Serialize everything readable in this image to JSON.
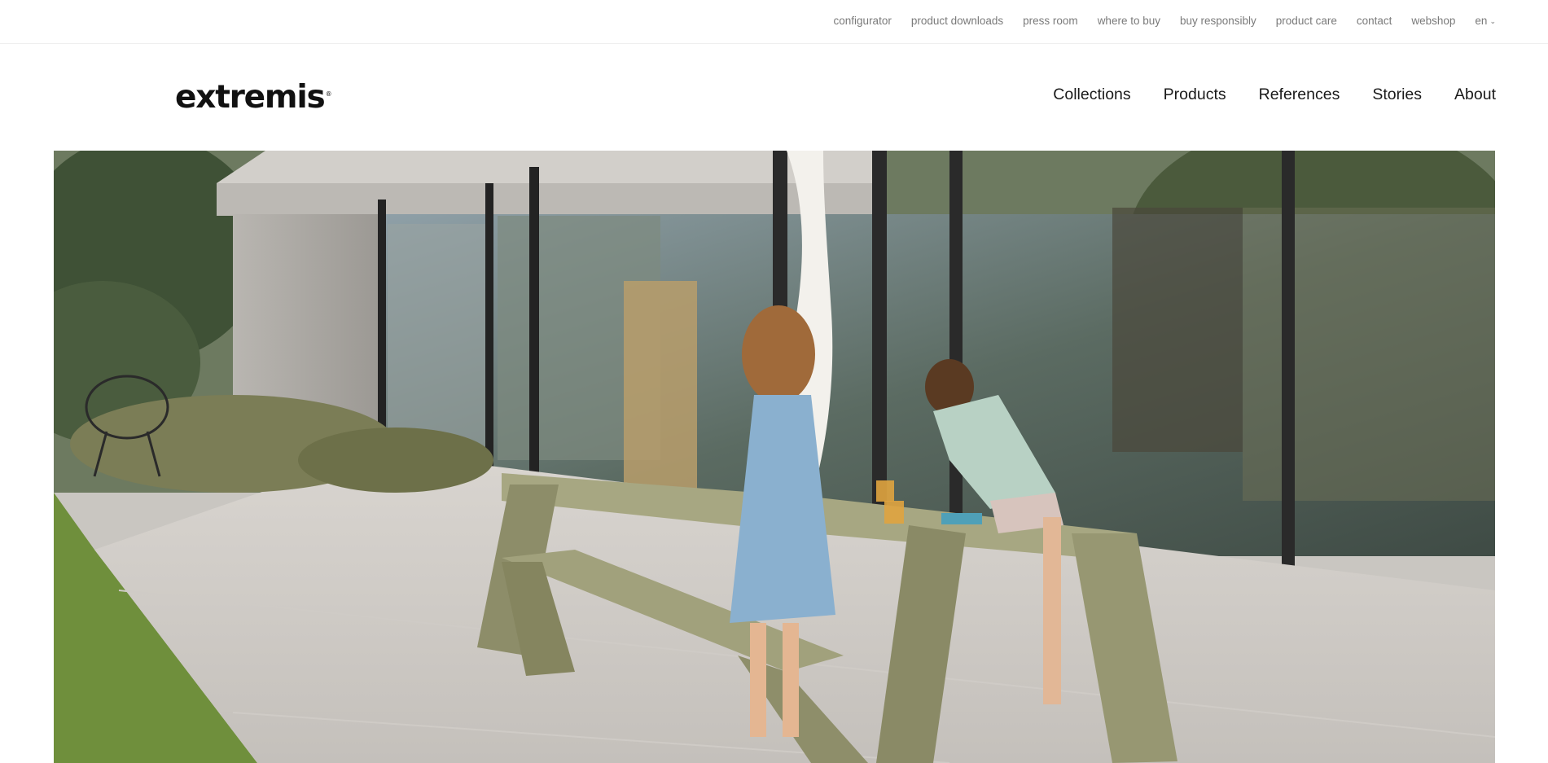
{
  "utility_nav": {
    "items": [
      {
        "label": "configurator"
      },
      {
        "label": "product downloads"
      },
      {
        "label": "press room"
      },
      {
        "label": "where to buy"
      },
      {
        "label": "buy responsibly"
      },
      {
        "label": "product care"
      },
      {
        "label": "contact"
      },
      {
        "label": "webshop"
      }
    ],
    "language": "en",
    "language_icon": "chevron-down-icon"
  },
  "brand": {
    "logo_text": "extremis",
    "registered_mark": "®"
  },
  "main_nav": {
    "items": [
      {
        "label": "Collections"
      },
      {
        "label": "Products"
      },
      {
        "label": "References"
      },
      {
        "label": "Stories"
      },
      {
        "label": "About"
      }
    ]
  },
  "colors": {
    "text": "#1a1a1a",
    "utility_text": "#7a7a7a",
    "table_green": "#9c9b78"
  }
}
